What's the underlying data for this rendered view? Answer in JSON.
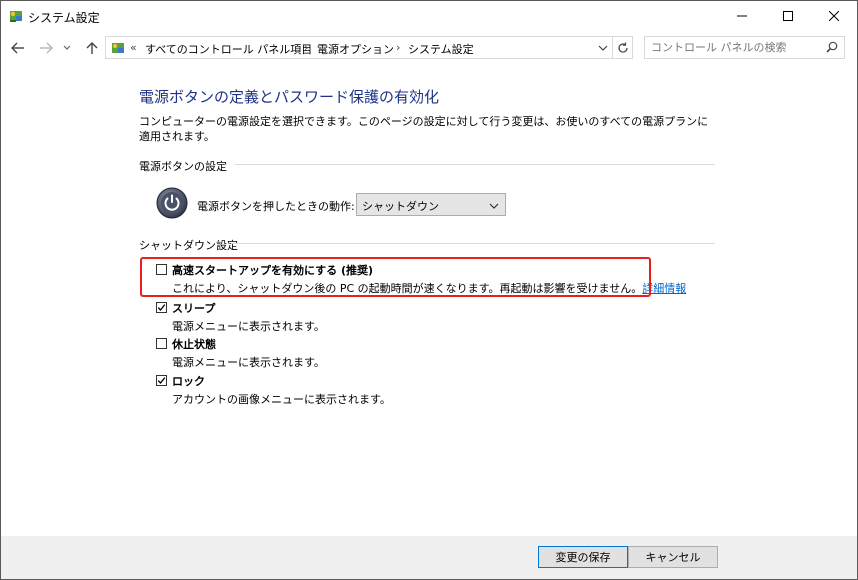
{
  "window": {
    "title": "システム設定"
  },
  "address": {
    "chevron": "«",
    "breadcrumbs": [
      "すべてのコントロール パネル項目",
      "電源オプション",
      "システム設定"
    ],
    "separator": "›"
  },
  "search": {
    "placeholder": "コントロール パネルの検索"
  },
  "content": {
    "heading": "電源ボタンの定義とパスワード保護の有効化",
    "description": "コンピューターの電源設定を選択できます。このページの設定に対して行う変更は、お使いのすべての電源プランに適用されます。"
  },
  "power_group": {
    "title": "電源ボタンの設定",
    "action_label": "電源ボタンを押したときの動作:",
    "action_value": "シャットダウン"
  },
  "shutdown_group": {
    "title": "シャットダウン設定",
    "options": [
      {
        "label": "高速スタートアップを有効にする (推奨)",
        "description": "これにより、シャットダウン後の PC の起動時間が速くなります。再起動は影響を受けません。",
        "link": "詳細情報",
        "checked": false
      },
      {
        "label": "スリープ",
        "description": "電源メニューに表示されます。",
        "checked": true
      },
      {
        "label": "休止状態",
        "description": "電源メニューに表示されます。",
        "checked": false
      },
      {
        "label": "ロック",
        "description": "アカウントの画像メニューに表示されます。",
        "checked": true
      }
    ]
  },
  "footer": {
    "save_label": "変更の保存",
    "cancel_label": "キャンセル"
  },
  "colors": {
    "heading": "#1e3287",
    "highlight": "#e8201b",
    "link": "#0066cc"
  }
}
